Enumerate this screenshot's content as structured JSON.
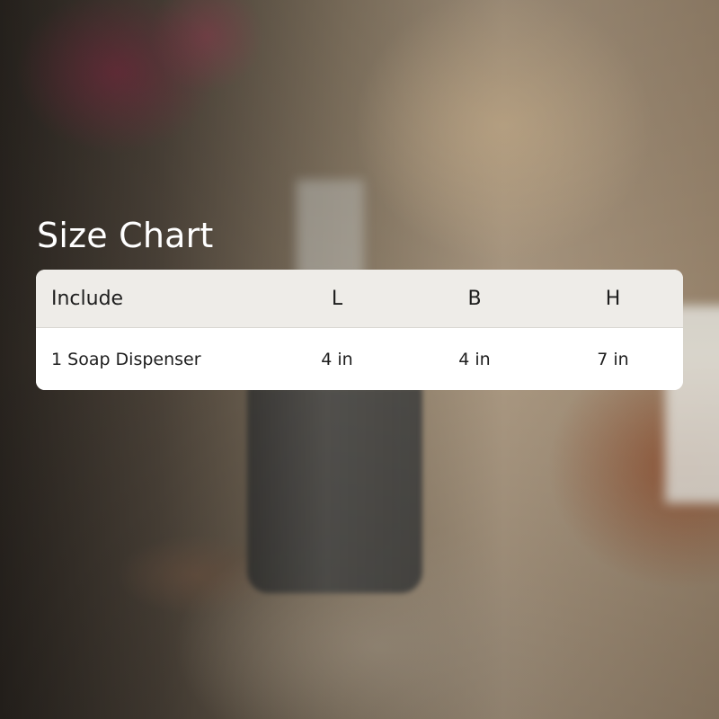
{
  "title": "Size Chart",
  "table": {
    "headers": [
      "Include",
      "L",
      "B",
      "H"
    ],
    "rows": [
      [
        "1 Soap Dispenser",
        "4 in",
        "4 in",
        "7 in"
      ]
    ]
  },
  "colors": {
    "title_text": "#ffffff",
    "header_bg": "#eeece8",
    "row_bg": "#ffffff",
    "text": "#1e1e1e"
  }
}
